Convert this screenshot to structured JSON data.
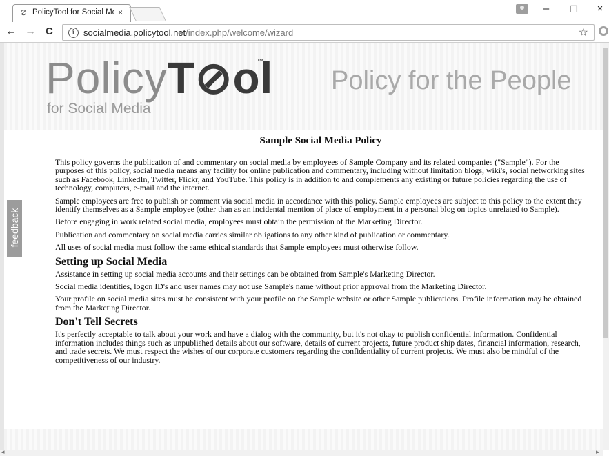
{
  "browser": {
    "tab_title": "PolicyTool for Social Med",
    "tab_close": "×",
    "url_host": "socialmedia.policytool.net",
    "url_path": "/index.php/welcome/wizard",
    "back": "←",
    "forward": "→",
    "reload": "C",
    "star": "☆",
    "minimize": "–",
    "restore": "❐",
    "close": "×"
  },
  "header": {
    "logo_prefix": "Policy",
    "logo_tool": "T⊘ol",
    "logo_tm": "™",
    "logo_sub": "for Social Media",
    "tagline": "Policy for the People"
  },
  "feedback": {
    "label": "feedback"
  },
  "document": {
    "title": "Sample Social Media Policy",
    "intro": [
      "This policy governs the publication of and commentary on social media by employees of Sample Company and its related companies (\"Sample\"). For the purposes of this policy, social media means any facility for online publication and commentary, including without limitation blogs, wiki's, social networking sites such as Facebook, LinkedIn, Twitter, Flickr, and YouTube. This policy is in addition to and complements any existing or future policies regarding the use of technology, computers, e-mail and the internet.",
      "Sample employees are free to publish or comment via social media in accordance with this policy. Sample employees are subject to this policy to the extent they identify themselves as a Sample employee (other than as an incidental mention of place of employment in a personal blog on topics unrelated to Sample).",
      "Before engaging in work related social media, employees must obtain the permission of the Marketing Director.",
      "Publication and commentary on social media carries similar obligations to any other kind of publication or commentary.",
      "All uses of social media must follow the same ethical standards that Sample employees must otherwise follow."
    ],
    "section1": {
      "heading": "Setting up Social Media",
      "paragraphs": [
        "Assistance in setting up social media accounts and their settings can be obtained from Sample's Marketing Director.",
        "Social media identities, logon ID's and user names may not use Sample's name without prior approval from the Marketing Director.",
        "Your profile on social media sites must be consistent with your profile on the Sample website or other Sample publications. Profile information may be obtained from the Marketing Director."
      ]
    },
    "section2": {
      "heading": "Don't Tell Secrets",
      "paragraphs": [
        "It's perfectly acceptable to talk about your work and have a dialog with the community, but it's not okay to publish confidential information. Confidential information includes things such as unpublished details about our software, details of current projects, future product ship dates, financial information, research, and trade secrets. We must respect the wishes of our corporate customers regarding the confidentiality of current projects. We must also be mindful of the competitiveness of our industry."
      ]
    }
  }
}
